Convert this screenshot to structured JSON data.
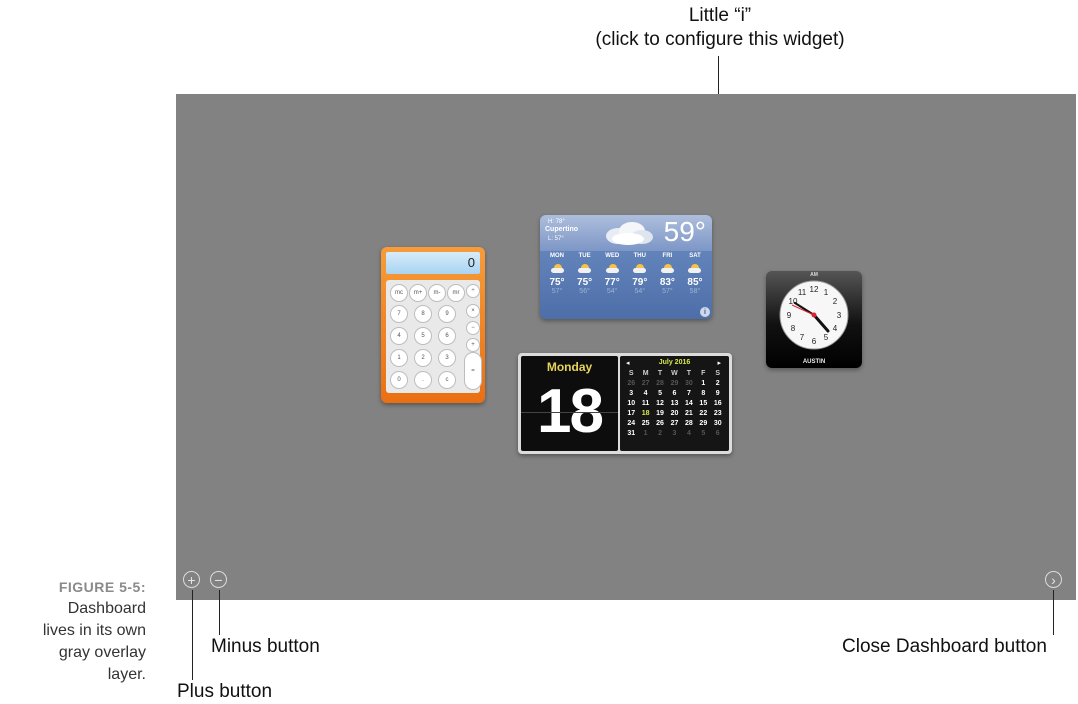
{
  "annotations": {
    "info_title": "Little “i”",
    "info_subtitle": "(click to configure this widget)",
    "minus": "Minus button",
    "plus": "Plus button",
    "close": "Close Dashboard button"
  },
  "caption": {
    "figure": "FIGURE 5-5:",
    "lines": [
      "Dashboard",
      "lives in its own",
      "gray overlay",
      "layer."
    ]
  },
  "controls": {
    "plus_icon": "+",
    "minus_icon": "−",
    "close_icon": "›"
  },
  "colors": {
    "overlay": "#828282",
    "calculator": "#f08a2a",
    "weather": "#5c7db5",
    "calendar_accent": "#d7e84b"
  },
  "calculator": {
    "display": "0",
    "keys": [
      "mc",
      "m+",
      "m-",
      "mr",
      "÷",
      "7",
      "8",
      "9",
      "×",
      "4",
      "5",
      "6",
      "−",
      "1",
      "2",
      "3",
      "+",
      "0",
      ".",
      "c",
      "="
    ]
  },
  "weather": {
    "hi": "H: 78°",
    "city": "Cupertino",
    "lo": "L: 57°",
    "current": "59°",
    "info_icon": "i",
    "days": [
      {
        "day": "MON",
        "high": "75°",
        "low": "57°"
      },
      {
        "day": "TUE",
        "high": "75°",
        "low": "56°"
      },
      {
        "day": "WED",
        "high": "77°",
        "low": "54°"
      },
      {
        "day": "THU",
        "high": "79°",
        "low": "54°"
      },
      {
        "day": "FRI",
        "high": "83°",
        "low": "57°"
      },
      {
        "day": "SAT",
        "high": "85°",
        "low": "58°"
      }
    ]
  },
  "clock": {
    "ampm": "AM",
    "city": "AUSTIN",
    "numerals": [
      "12",
      "1",
      "2",
      "3",
      "4",
      "5",
      "6",
      "7",
      "8",
      "9",
      "10",
      "11"
    ]
  },
  "calendar": {
    "day_name": "Monday",
    "day_number": "18",
    "month": "July 2016",
    "prev": "◂",
    "next": "▸",
    "weekdays": [
      "S",
      "M",
      "T",
      "W",
      "T",
      "F",
      "S"
    ],
    "weeks": [
      [
        "26",
        "27",
        "28",
        "29",
        "30",
        "1",
        "2"
      ],
      [
        "3",
        "4",
        "5",
        "6",
        "7",
        "8",
        "9"
      ],
      [
        "10",
        "11",
        "12",
        "13",
        "14",
        "15",
        "16"
      ],
      [
        "17",
        "18",
        "19",
        "20",
        "21",
        "22",
        "23"
      ],
      [
        "24",
        "25",
        "26",
        "27",
        "28",
        "29",
        "30"
      ],
      [
        "31",
        "1",
        "2",
        "3",
        "4",
        "5",
        "6"
      ]
    ],
    "today": "18"
  }
}
